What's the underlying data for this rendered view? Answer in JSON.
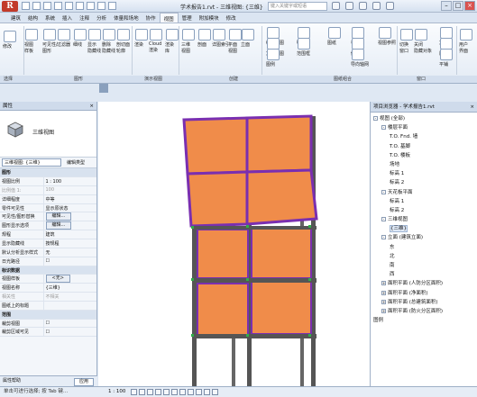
{
  "titlebar": {
    "app_logo": "R",
    "title": "学术报告1.rvt - 三维视图: {三维}",
    "search_placeholder": "键入关键字或短语"
  },
  "tabs": [
    "建筑",
    "结构",
    "系统",
    "插入",
    "注释",
    "分析",
    "体量和场地",
    "协作",
    "视图",
    "管理",
    "附加模块",
    "修改"
  ],
  "active_tab": "视图",
  "ribbon": {
    "buttons": [
      {
        "label": "修改"
      },
      {
        "label": "视图\n样板"
      },
      {
        "label": "可见性/\n图形"
      },
      {
        "label": "过滤器"
      },
      {
        "label": "细线"
      },
      {
        "label": "显示\n隐藏线"
      },
      {
        "label": "删除\n隐藏线"
      },
      {
        "label": "剖切面\n轮廓"
      },
      {
        "label": "渲染"
      },
      {
        "label": "Cloud\n渲染"
      },
      {
        "label": "渲染\n库"
      },
      {
        "label": "三维\n视图"
      },
      {
        "label": "剖面"
      },
      {
        "label": "详图索引"
      },
      {
        "label": "平面\n视图"
      },
      {
        "label": "立面"
      },
      {
        "label": "绘图视图"
      },
      {
        "label": "复制视图"
      },
      {
        "label": "图例"
      },
      {
        "label": "明细表"
      },
      {
        "label": "范围框"
      },
      {
        "label": "图纸"
      },
      {
        "label": "标题栏"
      },
      {
        "label": "修订"
      },
      {
        "label": "导向轴网"
      },
      {
        "label": "视图参照"
      },
      {
        "label": "切换\n窗口"
      },
      {
        "label": "关闭\n隐藏对象"
      },
      {
        "label": "复制"
      },
      {
        "label": "层叠"
      },
      {
        "label": "平铺"
      },
      {
        "label": "用户\n界面"
      }
    ],
    "groups": [
      "选择",
      "图形",
      "演示视图",
      "创建",
      "图纸组合",
      "窗口"
    ]
  },
  "properties": {
    "header": "属性",
    "close": "×",
    "type_name": "三维视图",
    "view_selector": "三维视图: {三维}",
    "edit_type": "编辑类型",
    "rows": [
      {
        "cat": true,
        "k": "图形",
        "v": ""
      },
      {
        "k": "视图比例",
        "v": "1 : 100"
      },
      {
        "k": "比例值 1:",
        "v": "100",
        "dim": true
      },
      {
        "k": "详细程度",
        "v": "中等"
      },
      {
        "k": "零件可见性",
        "v": "显示原状态"
      },
      {
        "k": "可见性/图形替换",
        "v": "编辑...",
        "btn": true
      },
      {
        "k": "图形显示选项",
        "v": "编辑...",
        "btn": true
      },
      {
        "k": "规程",
        "v": "建筑"
      },
      {
        "k": "显示隐藏线",
        "v": "按规程"
      },
      {
        "k": "默认分析显示样式",
        "v": "无"
      },
      {
        "k": "日光路径",
        "v": "☐"
      },
      {
        "cat": true,
        "k": "标识数据",
        "v": ""
      },
      {
        "k": "视图样板",
        "v": "<无>",
        "btn": true
      },
      {
        "k": "视图名称",
        "v": "{三维}"
      },
      {
        "k": "相关性",
        "v": "不相关",
        "dim": true
      },
      {
        "k": "图纸上的标题",
        "v": ""
      },
      {
        "cat": true,
        "k": "范围",
        "v": ""
      },
      {
        "k": "裁剪视图",
        "v": "☐"
      },
      {
        "k": "裁剪区域可见",
        "v": "☐"
      }
    ],
    "help": "属性帮助",
    "apply": "应用"
  },
  "browser": {
    "header": "项目浏览器 - 学术报告1.rvt",
    "close": "×",
    "items": [
      {
        "indent": 0,
        "toggle": "-",
        "label": "视图 (全部)"
      },
      {
        "indent": 1,
        "toggle": "-",
        "label": "楼层平面"
      },
      {
        "indent": 2,
        "toggle": "",
        "label": "T.O. Fnd. 墙"
      },
      {
        "indent": 2,
        "toggle": "",
        "label": "T.O. 基脚"
      },
      {
        "indent": 2,
        "toggle": "",
        "label": "T.O. 楼板"
      },
      {
        "indent": 2,
        "toggle": "",
        "label": "场地"
      },
      {
        "indent": 2,
        "toggle": "",
        "label": "标高 1"
      },
      {
        "indent": 2,
        "toggle": "",
        "label": "标高 2"
      },
      {
        "indent": 1,
        "toggle": "-",
        "label": "天花板平面"
      },
      {
        "indent": 2,
        "toggle": "",
        "label": "标高 1"
      },
      {
        "indent": 2,
        "toggle": "",
        "label": "标高 2"
      },
      {
        "indent": 1,
        "toggle": "-",
        "label": "三维视图"
      },
      {
        "indent": 2,
        "toggle": "",
        "label": "{三维}",
        "selected": true
      },
      {
        "indent": 1,
        "toggle": "-",
        "label": "立面 (建筑立面)"
      },
      {
        "indent": 2,
        "toggle": "",
        "label": "东"
      },
      {
        "indent": 2,
        "toggle": "",
        "label": "北"
      },
      {
        "indent": 2,
        "toggle": "",
        "label": "南"
      },
      {
        "indent": 2,
        "toggle": "",
        "label": "西"
      },
      {
        "indent": 1,
        "toggle": "+",
        "label": "面积平面 (人防分区面积)"
      },
      {
        "indent": 1,
        "toggle": "+",
        "label": "面积平面 (净面积)"
      },
      {
        "indent": 1,
        "toggle": "+",
        "label": "面积平面 (总建筑面积)"
      },
      {
        "indent": 1,
        "toggle": "+",
        "label": "面积平面 (防火分区面积)"
      },
      {
        "indent": 0,
        "toggle": "",
        "label": "图例"
      }
    ]
  },
  "status": {
    "info": "单击可进行选择; 按 Tab 键…",
    "scale": "1 : 100"
  },
  "colors": {
    "panel_fill": "#f08c4a",
    "frame_purple": "#7a2fb0",
    "column_gray": "#555555",
    "accent": "#c23a2a"
  }
}
